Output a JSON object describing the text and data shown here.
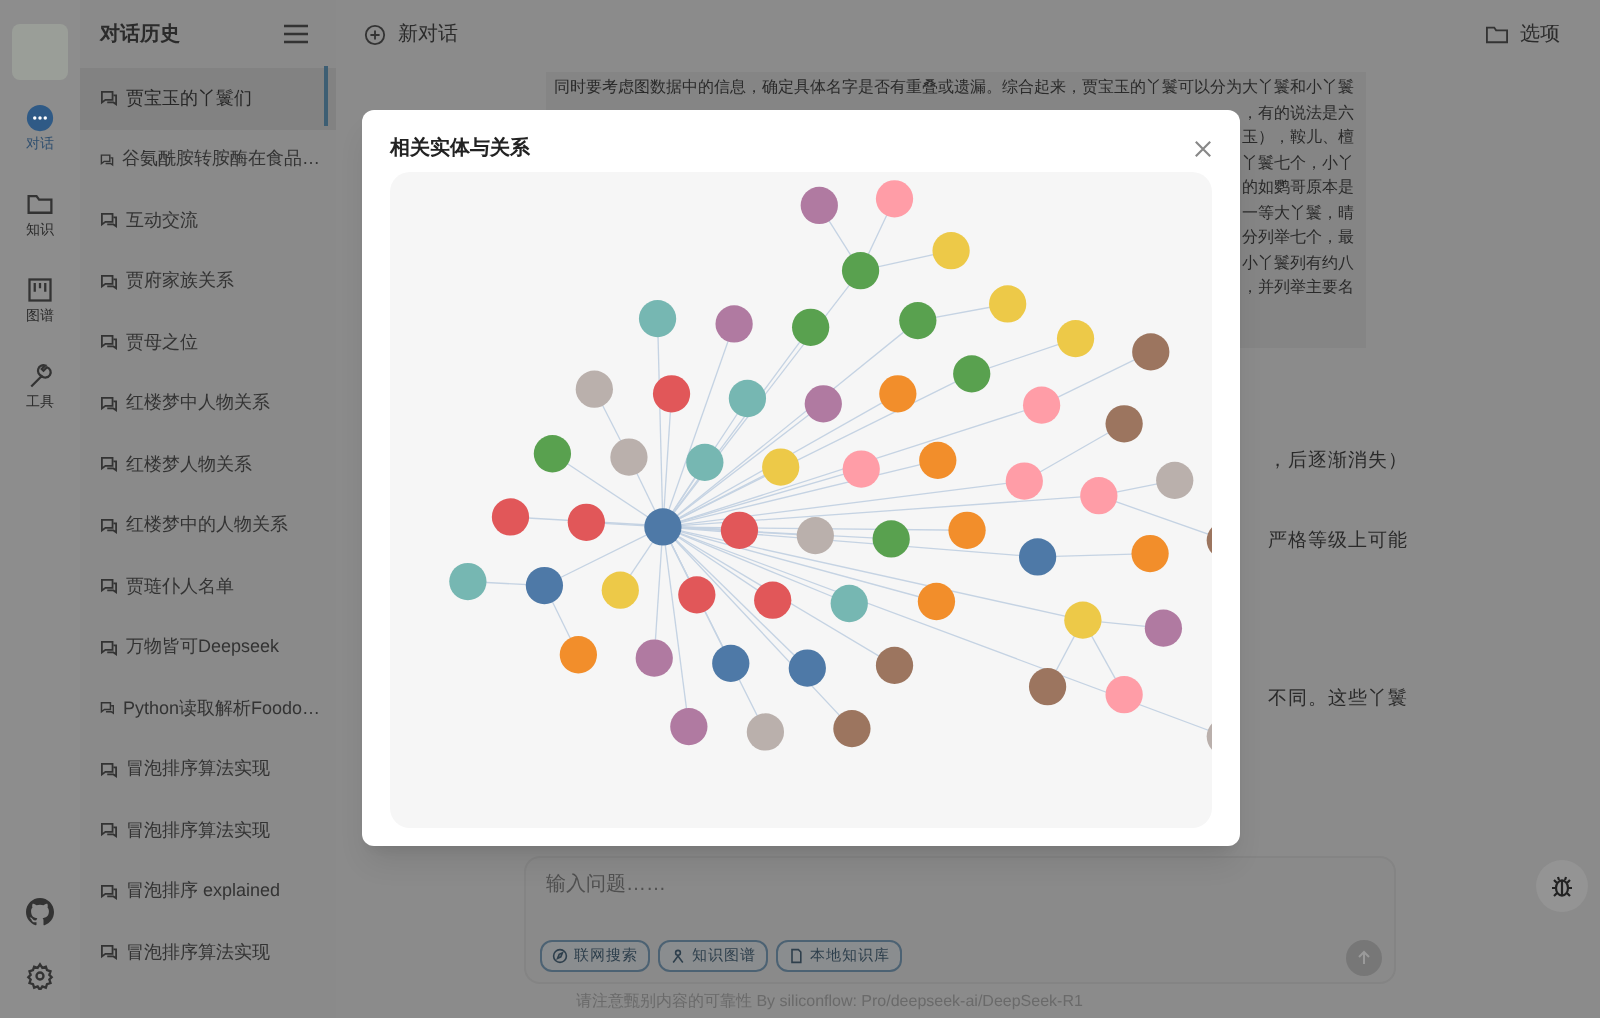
{
  "rail": {
    "items": [
      {
        "kind": "chat",
        "label": "对话",
        "selected": true
      },
      {
        "kind": "folder",
        "label": "知识",
        "selected": false
      },
      {
        "kind": "graph",
        "label": "图谱",
        "selected": false
      },
      {
        "kind": "tool",
        "label": "工具",
        "selected": false
      }
    ]
  },
  "history": {
    "title": "对话历史",
    "items": [
      {
        "label": "贾宝玉的丫鬟们",
        "selected": true
      },
      {
        "label": "谷氨酰胺转胺酶在食品…",
        "selected": false
      },
      {
        "label": "互动交流",
        "selected": false
      },
      {
        "label": "贾府家族关系",
        "selected": false
      },
      {
        "label": "贾母之位",
        "selected": false
      },
      {
        "label": "红楼梦中人物关系",
        "selected": false
      },
      {
        "label": "红楼梦人物关系",
        "selected": false
      },
      {
        "label": "红楼梦中的人物关系",
        "selected": false
      },
      {
        "label": "贾琏仆人名单",
        "selected": false
      },
      {
        "label": "万物皆可Deepseek",
        "selected": false
      },
      {
        "label": "Python读取解析Foodo…",
        "selected": false
      },
      {
        "label": "冒泡排序算法实现",
        "selected": false
      },
      {
        "label": "冒泡排序算法实现",
        "selected": false
      },
      {
        "label": "冒泡排序 explained",
        "selected": false
      },
      {
        "label": "冒泡排序算法实现",
        "selected": false
      }
    ]
  },
  "header": {
    "new_chat": "新对话",
    "options": "选项"
  },
  "message": {
    "card_lines": [
      "同时要考虑图数据中的信息，确定具体名字是否有重叠或遗漏。综合起来，贾宝玉的丫鬟可以分为大丫鬟和小丫鬟",
      "，有的说法是六",
      "玉），鞍儿、檀",
      "丫鬟七个，小丫",
      "的如鹦哥原本是",
      "一等大丫鬟，晴",
      "分列举七个，最",
      "小丫鬟列有约八",
      "，并列举主要名"
    ],
    "body_fragments": [
      "，后逐渐消失）",
      "严格等级上可能",
      "不同。这些丫鬟"
    ]
  },
  "modal": {
    "title": "相关实体与关系"
  },
  "composer": {
    "placeholder": "输入问题……",
    "tools": [
      {
        "kind": "web",
        "label": "联网搜索"
      },
      {
        "kind": "graph",
        "label": "知识图谱"
      },
      {
        "kind": "doc",
        "label": "本地知识库"
      }
    ]
  },
  "footer": "请注意甄别内容的可靠性 By siliconflow: Pro/deepseek-ai/DeepSeek-R1"
}
